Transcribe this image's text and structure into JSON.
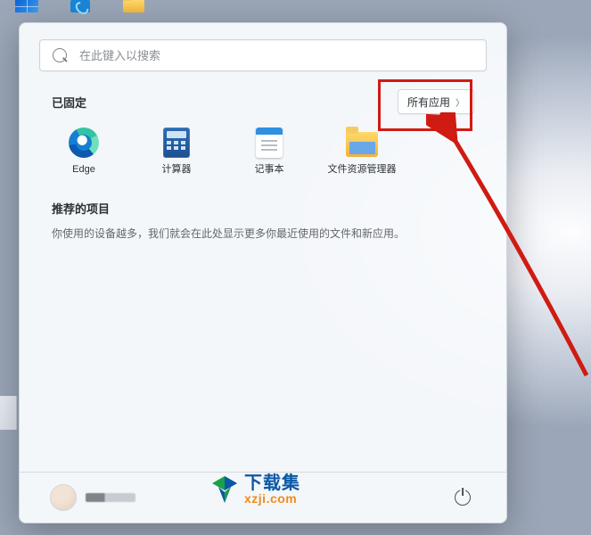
{
  "taskbar": {
    "icons": [
      "start-icon",
      "security-center-icon",
      "file-explorer-icon"
    ]
  },
  "search": {
    "placeholder": "在此键入以搜索"
  },
  "pinned": {
    "title": "已固定",
    "all_apps_label": "所有应用",
    "items": [
      {
        "label": "Edge",
        "icon": "edge-icon"
      },
      {
        "label": "计算器",
        "icon": "calculator-icon"
      },
      {
        "label": "记事本",
        "icon": "notepad-icon"
      },
      {
        "label": "文件资源管理器",
        "icon": "file-explorer-icon"
      }
    ]
  },
  "recommended": {
    "title": "推荐的项目",
    "empty_text": "你使用的设备越多，我们就会在此处显示更多你最近使用的文件和新应用。"
  },
  "footer": {
    "power_tooltip": "电源"
  },
  "watermark": {
    "zh": "下载集",
    "en": "xzji.com"
  },
  "annotation": {
    "highlight_target": "all-apps-button",
    "highlight_color": "#d01b12",
    "arrow_color": "#d01b12"
  }
}
